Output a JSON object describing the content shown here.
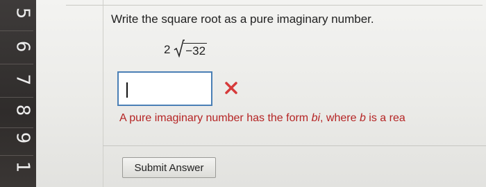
{
  "question_numbers": [
    "5",
    "6",
    "7",
    "8",
    "9",
    "1"
  ],
  "question": {
    "prompt": "Write the square root as a pure imaginary number.",
    "coefficient": "2",
    "radicand": "−32"
  },
  "answer": {
    "value": "",
    "status": "incorrect",
    "status_icon": "x-mark-icon"
  },
  "feedback": {
    "prefix": "A pure imaginary number has the form ",
    "form": "bi",
    "middle": ", where ",
    "var": "b",
    "suffix": " is a rea"
  },
  "submit": {
    "label": "Submit Answer"
  },
  "colors": {
    "input_border": "#4a7fb5",
    "error": "#b52424",
    "x_mark": "#d63a3a"
  }
}
